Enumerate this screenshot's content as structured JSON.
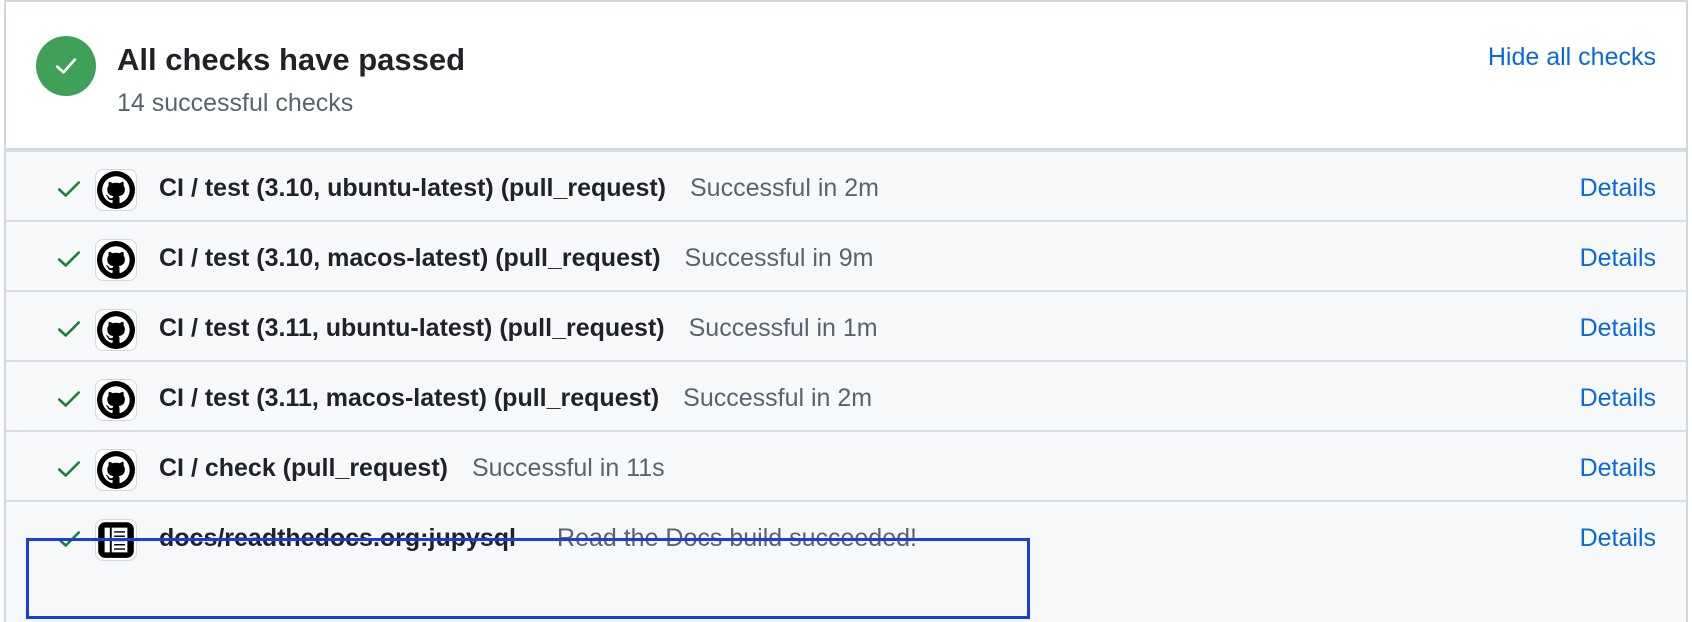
{
  "header": {
    "title": "All checks have passed",
    "subtitle": "14 successful checks",
    "hide_link": "Hide all checks",
    "status_icon": "check-circle-icon",
    "status_color": "#3fa05a"
  },
  "checks": [
    {
      "name": "CI / test (3.10, ubuntu-latest) (pull_request)",
      "separator": "",
      "description": "Successful in 2m",
      "details": "Details",
      "avatar_icon": "github-icon"
    },
    {
      "name": "CI / test (3.10, macos-latest) (pull_request)",
      "separator": "",
      "description": "Successful in 9m",
      "details": "Details",
      "avatar_icon": "github-icon"
    },
    {
      "name": "CI / test (3.11, ubuntu-latest) (pull_request)",
      "separator": "",
      "description": "Successful in 1m",
      "details": "Details",
      "avatar_icon": "github-icon"
    },
    {
      "name": "CI / test (3.11, macos-latest) (pull_request)",
      "separator": "",
      "description": "Successful in 2m",
      "details": "Details",
      "avatar_icon": "github-icon"
    },
    {
      "name": "CI / check (pull_request)",
      "separator": "",
      "description": "Successful in 11s",
      "details": "Details",
      "avatar_icon": "github-icon"
    },
    {
      "name": "docs/readthedocs.org:jupysql",
      "separator": "—",
      "description": "Read the Docs build succeeded!",
      "details": "Details",
      "avatar_icon": "readthedocs-icon"
    }
  ],
  "colors": {
    "link": "#0969da",
    "success": "#1a7f37",
    "highlight": "#1a3de0"
  }
}
